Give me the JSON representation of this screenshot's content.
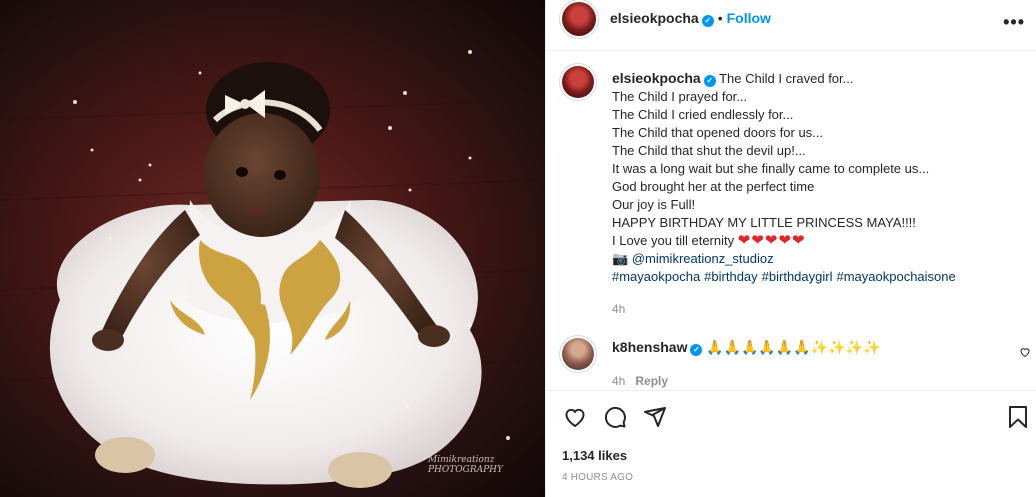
{
  "post": {
    "author": "elsieokpocha",
    "follow_label": "Follow",
    "separator": "•",
    "more_label": "•••",
    "verified_mark": "✓",
    "photo_watermark": "Mimikreationz PHOTOGRAPHY"
  },
  "caption": {
    "author": "elsieokpocha",
    "lines": [
      "The Child I craved for...",
      "The Child I prayed for...",
      "The Child I cried endlessly for...",
      "The Child that opened doors for us...",
      "The Child that shut the devil up!...",
      "It was a long wait but she finally came to complete us...",
      "God brought her at the perfect time",
      "Our joy is Full!",
      "HAPPY BIRTHDAY MY LITTLE PRINCESS MAYA!!!!",
      "I Love you till eternity"
    ],
    "hearts": "❤❤❤❤❤",
    "camera_emoji": "📷",
    "credit": "@mimikreationz_studioz",
    "hashtags": [
      "#mayaokpocha",
      "#birthday",
      "#birthdaygirl",
      "#mayaokpochaisone"
    ],
    "time": "4h"
  },
  "comment": {
    "author": "k8henshaw",
    "emojis": "🙏🙏🙏🙏🙏🙏✨✨✨✨",
    "time": "4h",
    "reply_label": "Reply"
  },
  "stats": {
    "likes": "1,134 likes",
    "time_ago": "4 HOURS AGO"
  },
  "icons": {
    "like": "heart-icon",
    "comment": "comment-icon",
    "share": "share-icon",
    "save": "bookmark-icon",
    "more": "more-options-icon"
  },
  "colors": {
    "accent": "#0095f6",
    "link": "#00376b",
    "heart": "#e0262b",
    "muted": "#8e8e8e"
  }
}
